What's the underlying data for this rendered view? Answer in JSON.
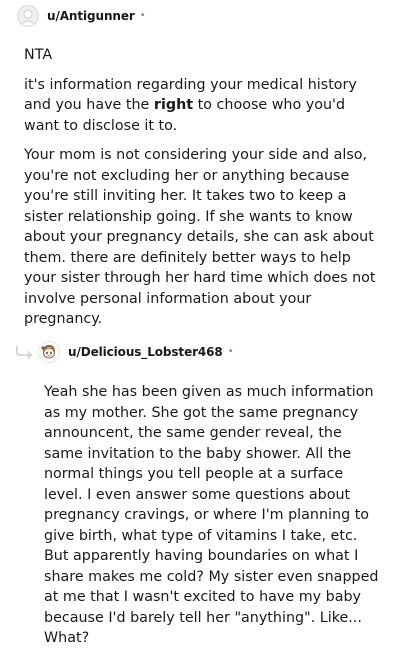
{
  "comment1": {
    "username": "u/Antigunner",
    "separator": "•",
    "paragraph1": "NTA",
    "paragraph2_before": "it's information regarding your medical history and you have the ",
    "paragraph2_bold": "right",
    "paragraph2_after": " to choose who you'd want to disclose it to.",
    "paragraph3": "Your mom is not considering your side and also, you're not excluding her or anything because you're still inviting her. It takes two to keep a sister relationship going. If she wants to know about your pregnancy details, she can ask about them. there are definitely better ways to help your sister through her hard time which does not involve personal information about your pregnancy."
  },
  "comment2": {
    "username": "u/Delicious_Lobster468",
    "separator": "•",
    "paragraph1": "Yeah she has been given as much information as my mother. She got the same pregnancy announcent, the same gender reveal, the same invitation to the baby shower. All the normal things you tell people at a surface level. I even answer some questions about pregnancy cravings, or where I'm planning to give birth, what type of vitamins I take, etc. But apparently having boundaries on what I share makes me cold? My sister even snapped at me that I wasn't excited to have my baby because I'd barely tell her \"anything\". Like... What?"
  }
}
